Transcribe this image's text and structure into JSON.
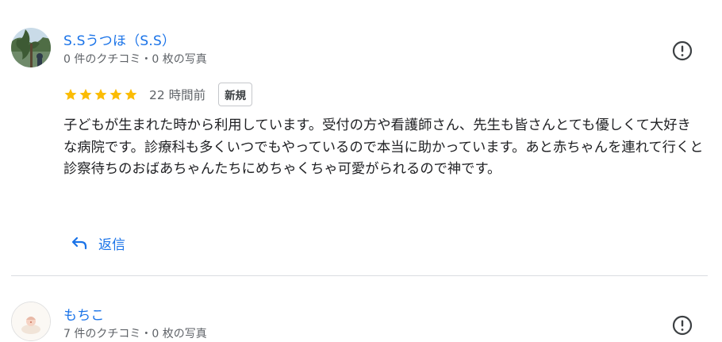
{
  "reviews": [
    {
      "author": "S.Sうつほ（S.S）",
      "meta": "0 件のクチコミ・0 枚の写真",
      "rating": 5,
      "time": "22 時間前",
      "badge": "新規",
      "text": "子どもが生まれた時から利用しています。受付の方や看護師さん、先生も皆さんとても優しくて大好きな病院です。診療科も多くいつでもやっているので本当に助かっています。あと赤ちゃんを連れて行くと診察待ちのおばあちゃんたちにめちゃくちゃ可愛がられるので神です。",
      "reply_label": "返信",
      "report_icon": "report-icon"
    },
    {
      "author": "もちこ",
      "meta": "7 件のクチコミ・0 枚の写真",
      "report_icon": "report-icon"
    }
  ],
  "colors": {
    "link": "#1a73e8",
    "star": "#fbbc04",
    "muted": "#5f6368",
    "divider": "#dadce0"
  }
}
